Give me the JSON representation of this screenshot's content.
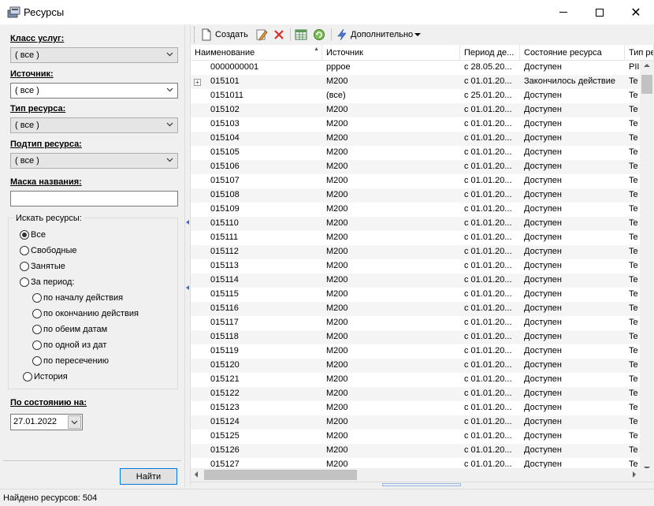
{
  "window": {
    "title": "Ресурсы"
  },
  "filters": {
    "service_class": {
      "label": "Класс услуг:",
      "value": "( все )"
    },
    "source": {
      "label": "Источник:",
      "value": "( все )"
    },
    "resource_type": {
      "label": "Тип ресурса:",
      "value": "( все )"
    },
    "resource_subtype": {
      "label": "Подтип ресурса:",
      "value": "( все )"
    },
    "name_mask": {
      "label": "Маска названия:",
      "value": ""
    },
    "search_group": {
      "title": "Искать ресурсы:",
      "options": [
        "Все",
        "Свободные",
        "Занятые",
        "За период:"
      ],
      "period_options": [
        "по началу действия",
        "по окончанию действия",
        "по обеим датам",
        "по одной из дат",
        "по пересечению"
      ],
      "history": "История",
      "selected": "Все"
    },
    "state_date": {
      "label": "По состоянию на:",
      "value": "27.01.2022"
    },
    "find_button": "Найти"
  },
  "toolbar": {
    "create": "Создать",
    "more": "Дополнительно"
  },
  "grid": {
    "columns": [
      "Наименование",
      "Источник",
      "Период де...",
      "Состояние ресурса",
      "Тип ре..."
    ],
    "rows": [
      [
        "0000000001",
        "рррое",
        "с 28.05.20...",
        "Доступен",
        "PII"
      ],
      [
        "015101",
        "M200",
        "с 01.01.20...",
        "Закончилось действие",
        "Te"
      ],
      [
        "0151011",
        "(все)",
        "с 25.01.20...",
        "Доступен",
        "Te"
      ],
      [
        "015102",
        "M200",
        "с 01.01.20...",
        "Доступен",
        "Te"
      ],
      [
        "015103",
        "M200",
        "с 01.01.20...",
        "Доступен",
        "Te"
      ],
      [
        "015104",
        "M200",
        "с 01.01.20...",
        "Доступен",
        "Te"
      ],
      [
        "015105",
        "M200",
        "с 01.01.20...",
        "Доступен",
        "Te"
      ],
      [
        "015106",
        "M200",
        "с 01.01.20...",
        "Доступен",
        "Te"
      ],
      [
        "015107",
        "M200",
        "с 01.01.20...",
        "Доступен",
        "Te"
      ],
      [
        "015108",
        "M200",
        "с 01.01.20...",
        "Доступен",
        "Te"
      ],
      [
        "015109",
        "M200",
        "с 01.01.20...",
        "Доступен",
        "Te"
      ],
      [
        "015110",
        "M200",
        "с 01.01.20...",
        "Доступен",
        "Te"
      ],
      [
        "015111",
        "M200",
        "с 01.01.20...",
        "Доступен",
        "Te"
      ],
      [
        "015112",
        "M200",
        "с 01.01.20...",
        "Доступен",
        "Te"
      ],
      [
        "015113",
        "M200",
        "с 01.01.20...",
        "Доступен",
        "Te"
      ],
      [
        "015114",
        "M200",
        "с 01.01.20...",
        "Доступен",
        "Te"
      ],
      [
        "015115",
        "M200",
        "с 01.01.20...",
        "Доступен",
        "Te"
      ],
      [
        "015116",
        "M200",
        "с 01.01.20...",
        "Доступен",
        "Te"
      ],
      [
        "015117",
        "M200",
        "с 01.01.20...",
        "Доступен",
        "Te"
      ],
      [
        "015118",
        "M200",
        "с 01.01.20...",
        "Доступен",
        "Te"
      ],
      [
        "015119",
        "M200",
        "с 01.01.20...",
        "Доступен",
        "Te"
      ],
      [
        "015120",
        "M200",
        "с 01.01.20...",
        "Доступен",
        "Te"
      ],
      [
        "015121",
        "M200",
        "с 01.01.20...",
        "Доступен",
        "Te"
      ],
      [
        "015122",
        "M200",
        "с 01.01.20...",
        "Доступен",
        "Te"
      ],
      [
        "015123",
        "M200",
        "с 01.01.20...",
        "Доступен",
        "Te"
      ],
      [
        "015124",
        "M200",
        "с 01.01.20...",
        "Доступен",
        "Te"
      ],
      [
        "015125",
        "M200",
        "с 01.01.20...",
        "Доступен",
        "Te"
      ],
      [
        "015126",
        "M200",
        "с 01.01.20...",
        "Доступен",
        "Te"
      ],
      [
        "015127",
        "M200",
        "с 01.01.20...",
        "Доступен",
        "Te"
      ]
    ],
    "expandable_row_index": 1
  },
  "status": {
    "text": "Найдено ресурсов: 504"
  },
  "colors": {
    "accent": "#0078d7",
    "row_alt": "#f5f5f5"
  }
}
